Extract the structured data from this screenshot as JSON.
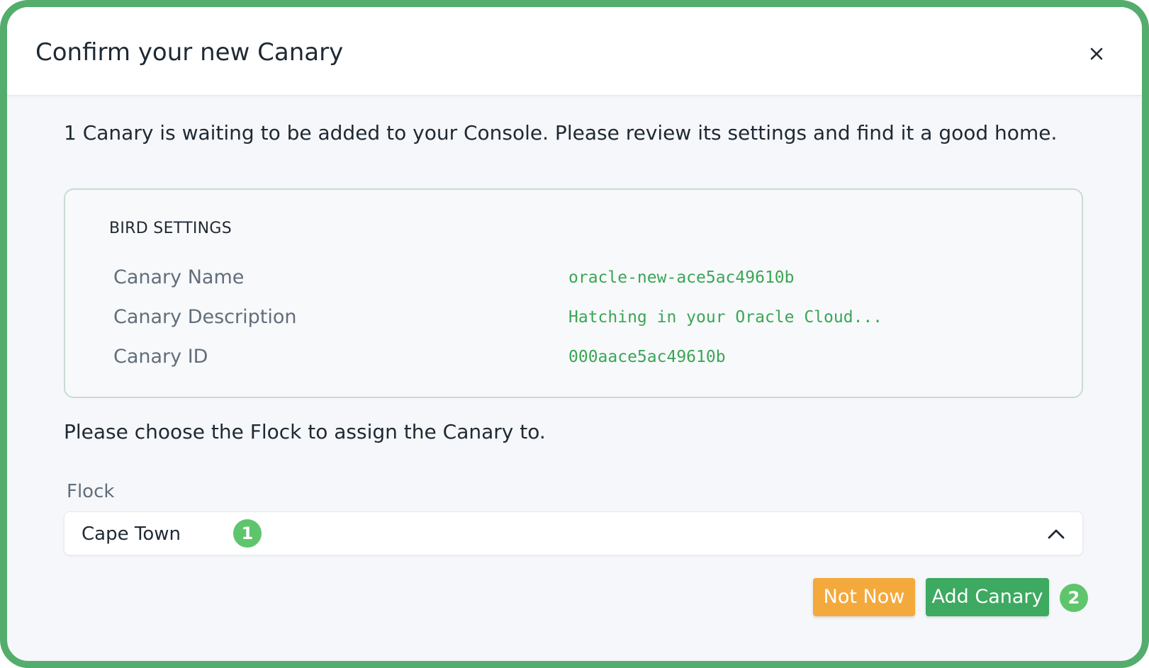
{
  "dialog": {
    "title": "Confirm your new Canary",
    "close_icon": "close-icon",
    "intro": "1 Canary is waiting to be added to your Console. Please review its settings and find it a good home."
  },
  "bird_settings": {
    "heading": "BIRD SETTINGS",
    "rows": [
      {
        "label": "Canary Name",
        "value": "oracle-new-ace5ac49610b"
      },
      {
        "label": "Canary Description",
        "value": "Hatching in your Oracle Cloud..."
      },
      {
        "label": "Canary ID",
        "value": "000aace5ac49610b"
      }
    ]
  },
  "flock": {
    "prompt": "Please choose the Flock to assign the Canary to.",
    "label": "Flock",
    "selected": "Cape Town",
    "chevron_icon": "chevron-up-icon"
  },
  "buttons": {
    "not_now": "Not Now",
    "add_canary": "Add Canary"
  },
  "badges": {
    "step1": "1",
    "step2": "2"
  },
  "colors": {
    "frame": "#54ad6d",
    "value_green": "#3aa655",
    "not_now": "#f4a93c",
    "add_canary": "#3da961",
    "badge": "#5fc56c"
  }
}
